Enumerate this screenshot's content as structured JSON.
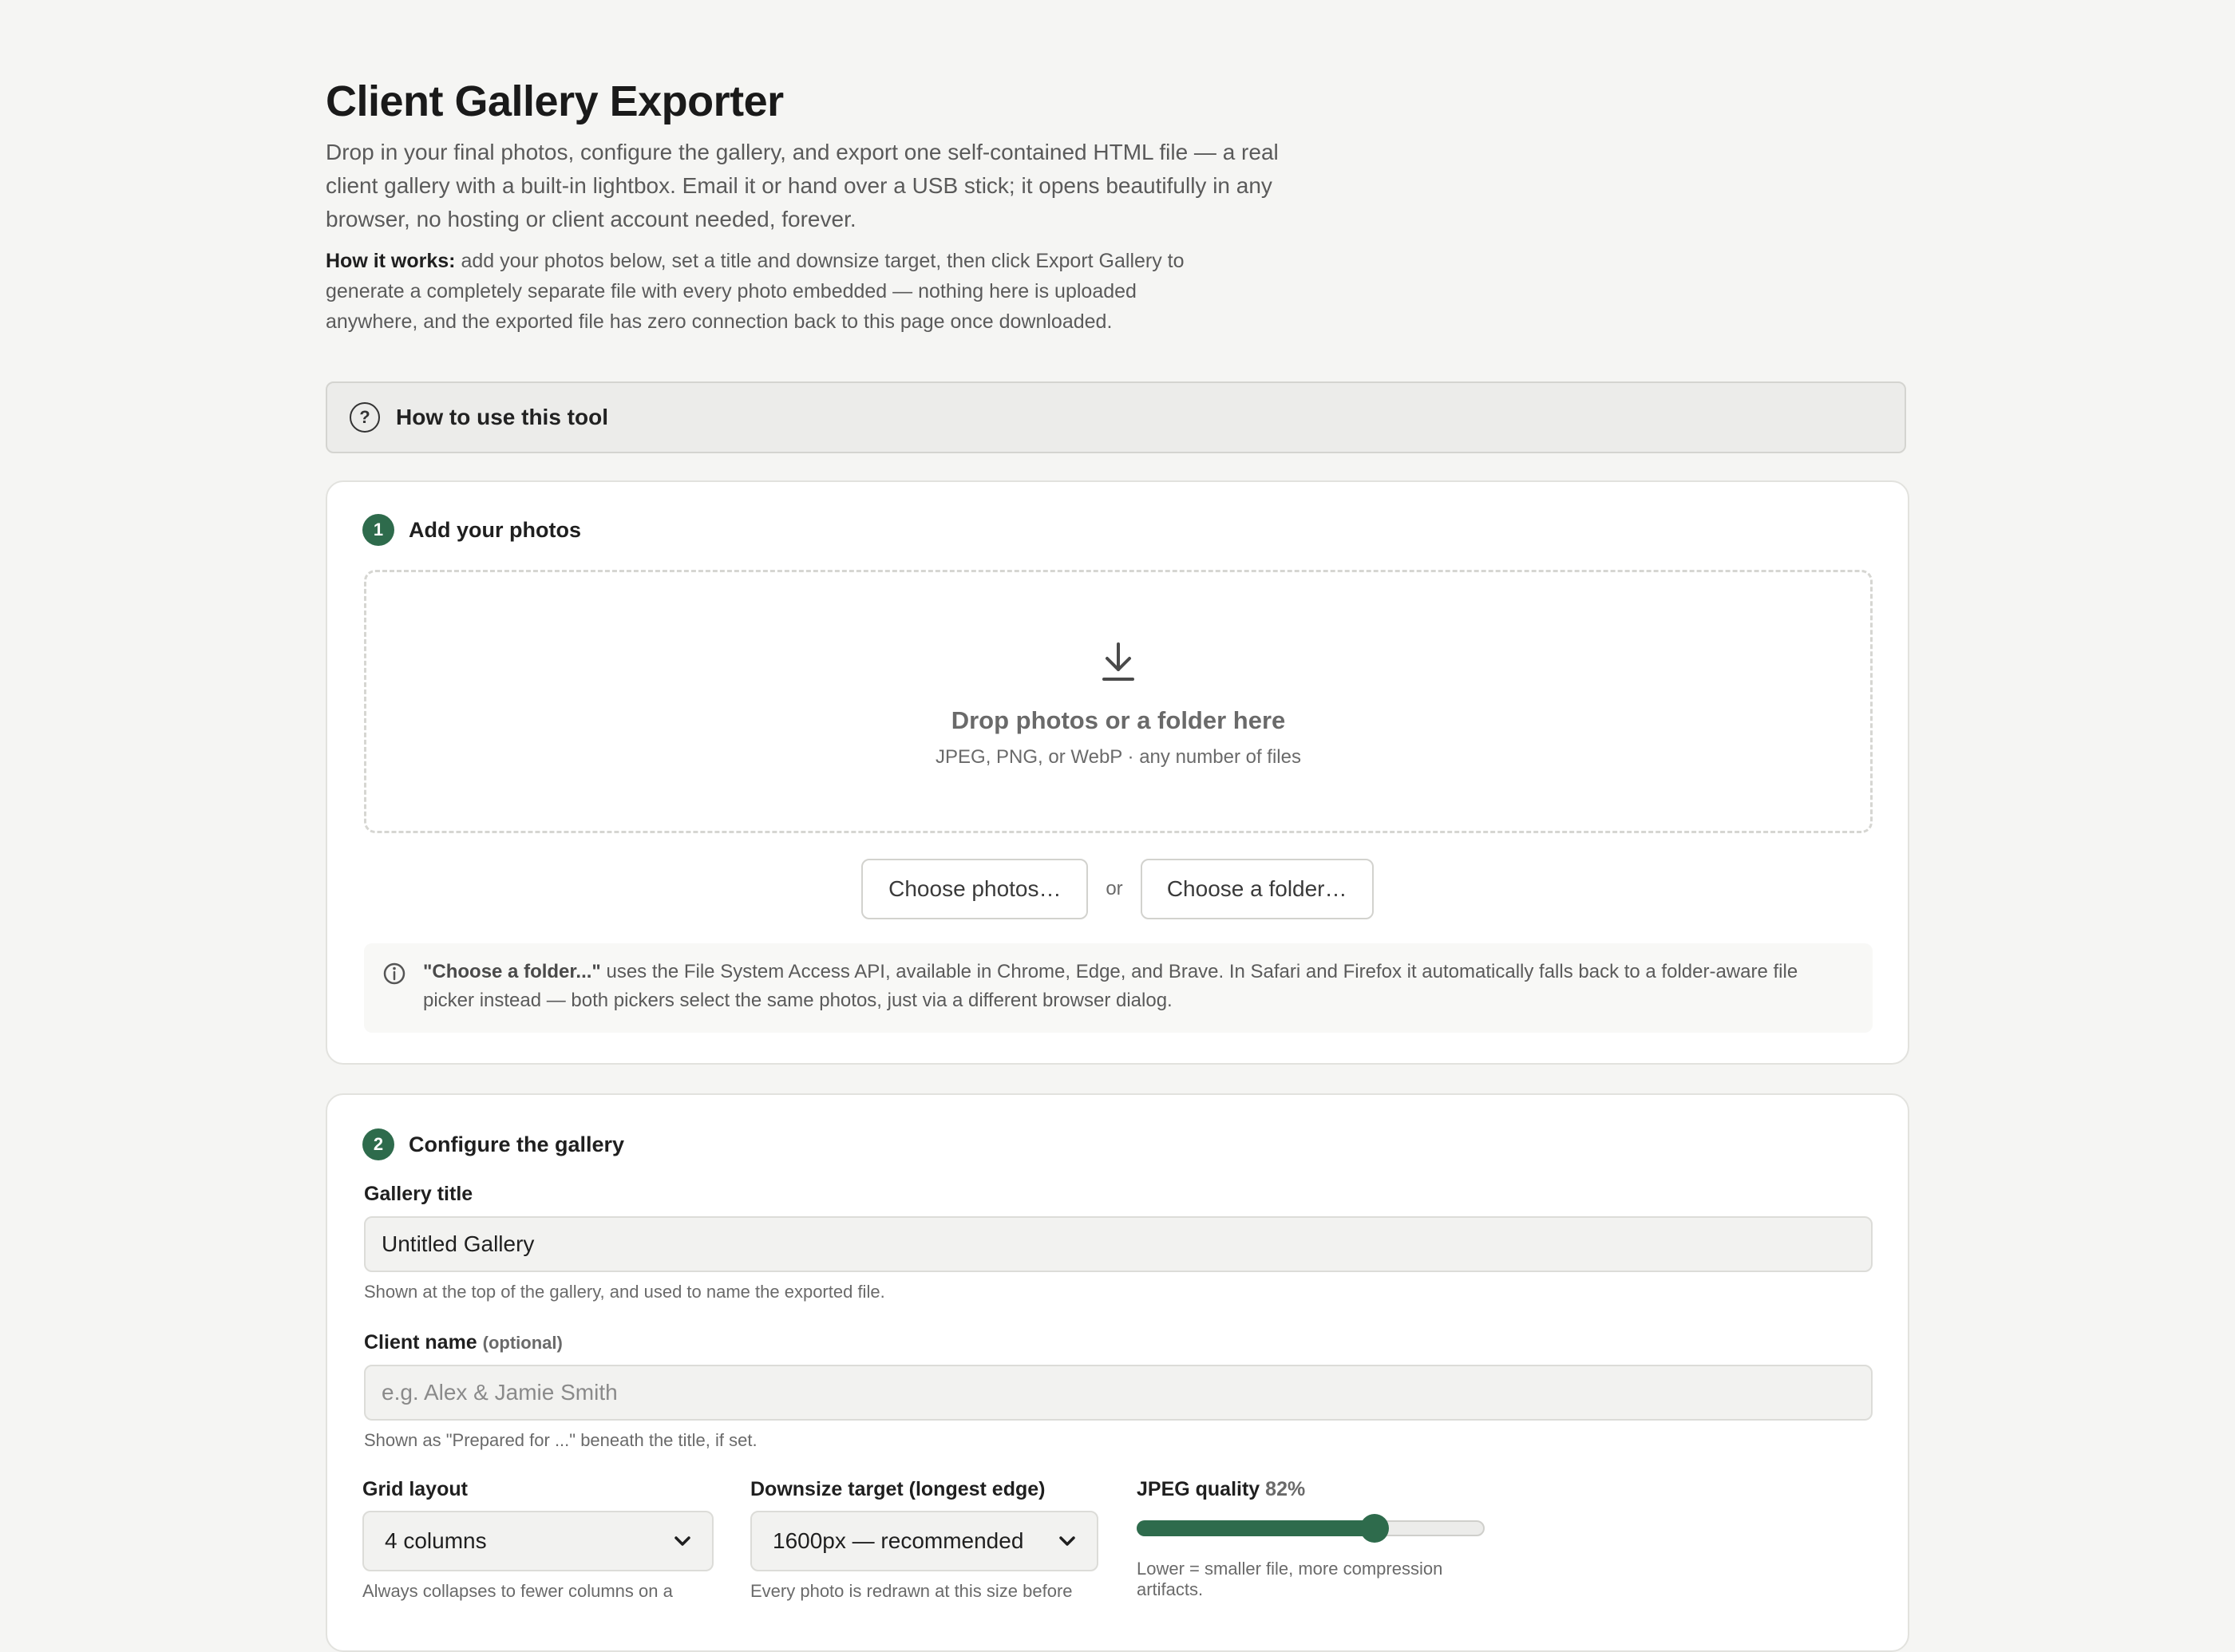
{
  "header": {
    "title": "Client Gallery Exporter",
    "intro": "Drop in your final photos, configure the gallery, and export one self-contained HTML file — a real client gallery with a built-in lightbox. Email it or hand over a USB stick; it opens beautifully in any browser, no hosting or client account needed, forever.",
    "how_it_works_label": "How it works:",
    "how_it_works_text": " add your photos below, set a title and downsize target, then click Export Gallery to generate a completely separate file with every photo embedded — nothing here is uploaded anywhere, and the exported file has zero connection back to this page once downloaded."
  },
  "help_bar": {
    "icon": "question-circle-icon",
    "glyph": "?",
    "label": "How to use this tool"
  },
  "step1": {
    "number": "1",
    "label": "Add your photos",
    "dropzone": {
      "icon": "download-arrow-icon",
      "title": "Drop photos or a folder here",
      "subtitle": "JPEG, PNG, or WebP · any number of files"
    },
    "choose_photos": "Choose photos…",
    "or": "or",
    "choose_folder": "Choose a folder…",
    "note": {
      "icon": "info-icon",
      "bold": "\"Choose a folder...\"",
      "text": " uses the File System Access API, available in Chrome, Edge, and Brave. In Safari and Firefox it automatically falls back to a folder-aware file picker instead — both pickers select the same photos, just via a different browser dialog."
    }
  },
  "step2": {
    "number": "2",
    "label": "Configure the gallery",
    "gallery_title": {
      "label": "Gallery title",
      "value": "Untitled Gallery",
      "hint": "Shown at the top of the gallery, and used to name the exported file."
    },
    "client_name": {
      "label": "Client name",
      "optional": "(optional)",
      "placeholder": "e.g. Alex & Jamie Smith",
      "hint": "Shown as \"Prepared for ...\" beneath the title, if set."
    },
    "grid_layout": {
      "label": "Grid layout",
      "selected": "4 columns",
      "hint": "Always collapses to fewer columns on a"
    },
    "downsize": {
      "label": "Downsize target (longest edge)",
      "selected": "1600px — recommended",
      "hint": "Every photo is redrawn at this size before"
    },
    "jpeg_quality": {
      "label": "JPEG quality",
      "value_text": "82%",
      "value": 82,
      "hint_line1": "Lower = smaller file, more compression",
      "hint_line2": "artifacts."
    }
  },
  "colors": {
    "accent": "#2e6b4c",
    "background": "#f5f5f3",
    "card": "#ffffff"
  }
}
